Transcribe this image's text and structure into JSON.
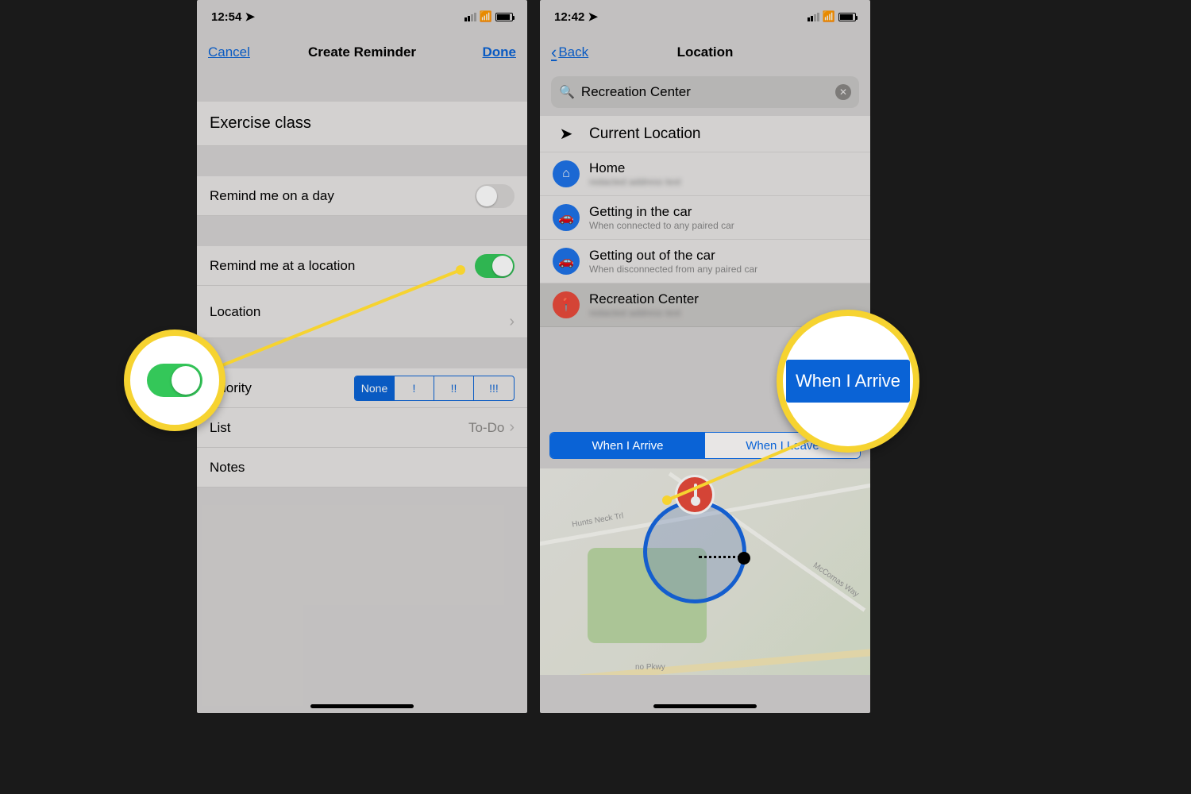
{
  "left": {
    "time": "12:54",
    "nav": {
      "cancel": "Cancel",
      "title": "Create Reminder",
      "done": "Done"
    },
    "reminder_title": "Exercise class",
    "rows": {
      "remind_day": "Remind me on a day",
      "remind_location": "Remind me at a location",
      "location": "Location",
      "priority": "Priority",
      "list": "List",
      "list_value": "To-Do",
      "notes": "Notes"
    },
    "priority_options": [
      "None",
      "!",
      "!!",
      "!!!"
    ],
    "priority_selected": "None"
  },
  "right": {
    "time": "12:42",
    "nav": {
      "back": "Back",
      "title": "Location"
    },
    "search_value": "Recreation Center",
    "current": "Current Location",
    "items": [
      {
        "title": "Home",
        "sub": "redacted address text"
      },
      {
        "title": "Getting in the car",
        "sub": "When connected to any paired car"
      },
      {
        "title": "Getting out of the car",
        "sub": "When disconnected from any paired car"
      },
      {
        "title": "Recreation Center",
        "sub": "redacted address text"
      }
    ],
    "arrive_leave": {
      "arrive": "When I Arrive",
      "leave": "When I Leave",
      "selected": "arrive"
    },
    "map_labels": {
      "road1": "Hunts Neck Trl",
      "road2": "McComas Way",
      "road3": "no Pkwy"
    }
  },
  "callouts": {
    "arrive_big": "When I Arrive"
  }
}
